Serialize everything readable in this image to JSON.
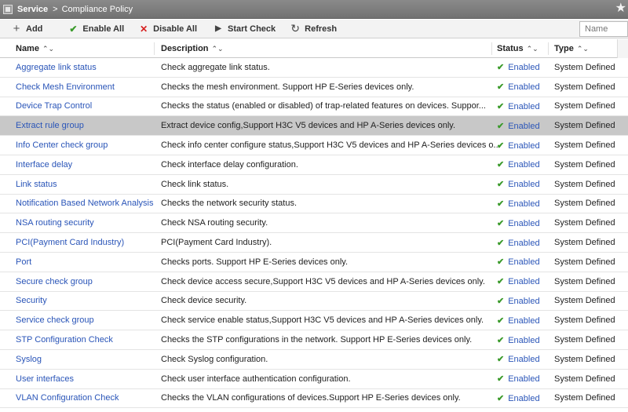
{
  "breadcrumb": {
    "service": "Service",
    "separator": ">",
    "page": "Compliance Policy"
  },
  "toolbar": {
    "add_label": "Add",
    "enable_all_label": "Enable All",
    "disable_all_label": "Disable All",
    "start_check_label": "Start Check",
    "refresh_label": "Refresh",
    "search_placeholder": "Name"
  },
  "table": {
    "headers": {
      "name": "Name",
      "description": "Description",
      "status": "Status",
      "type": "Type"
    },
    "selected_index": 3,
    "rows": [
      {
        "name": "Aggregate link status",
        "description": "Check aggregate link status.",
        "status": "Enabled",
        "type": "System Defined"
      },
      {
        "name": "Check Mesh Environment",
        "description": "Checks the mesh environment. Support HP E-Series devices only.",
        "status": "Enabled",
        "type": "System Defined"
      },
      {
        "name": "Device Trap Control",
        "description": "Checks the status (enabled or disabled) of trap-related features on devices. Suppor...",
        "status": "Enabled",
        "type": "System Defined"
      },
      {
        "name": "Extract rule group",
        "description": "Extract device config,Support H3C V5 devices and HP A-Series devices only.",
        "status": "Enabled",
        "type": "System Defined"
      },
      {
        "name": "Info Center check group",
        "description": "Check info center configure status,Support H3C V5 devices and HP A-Series devices o...",
        "status": "Enabled",
        "type": "System Defined"
      },
      {
        "name": "Interface delay",
        "description": "Check interface delay configuration.",
        "status": "Enabled",
        "type": "System Defined"
      },
      {
        "name": "Link status",
        "description": "Check link status.",
        "status": "Enabled",
        "type": "System Defined"
      },
      {
        "name": "Notification Based Network Analysis",
        "description": "Checks the network security status.",
        "status": "Enabled",
        "type": "System Defined"
      },
      {
        "name": "NSA routing security",
        "description": "Check NSA routing security.",
        "status": "Enabled",
        "type": "System Defined"
      },
      {
        "name": "PCI(Payment Card Industry)",
        "description": "PCI(Payment Card Industry).",
        "status": "Enabled",
        "type": "System Defined"
      },
      {
        "name": "Port",
        "description": "Checks ports. Support HP E-Series devices only.",
        "status": "Enabled",
        "type": "System Defined"
      },
      {
        "name": "Secure check group",
        "description": "Check device access secure,Support H3C V5 devices and HP A-Series devices only.",
        "status": "Enabled",
        "type": "System Defined"
      },
      {
        "name": "Security",
        "description": "Check device security.",
        "status": "Enabled",
        "type": "System Defined"
      },
      {
        "name": "Service check group",
        "description": "Check service enable status,Support H3C V5 devices and HP A-Series devices only.",
        "status": "Enabled",
        "type": "System Defined"
      },
      {
        "name": "STP Configuration Check",
        "description": "Checks the STP configurations in the network. Support HP E-Series devices only.",
        "status": "Enabled",
        "type": "System Defined"
      },
      {
        "name": "Syslog",
        "description": "Check Syslog configuration.",
        "status": "Enabled",
        "type": "System Defined"
      },
      {
        "name": "User interfaces",
        "description": "Check user interface authentication configuration.",
        "status": "Enabled",
        "type": "System Defined"
      },
      {
        "name": "VLAN Configuration Check",
        "description": "Checks the VLAN configurations of devices.Support HP E-Series devices only.",
        "status": "Enabled",
        "type": "System Defined"
      }
    ]
  }
}
